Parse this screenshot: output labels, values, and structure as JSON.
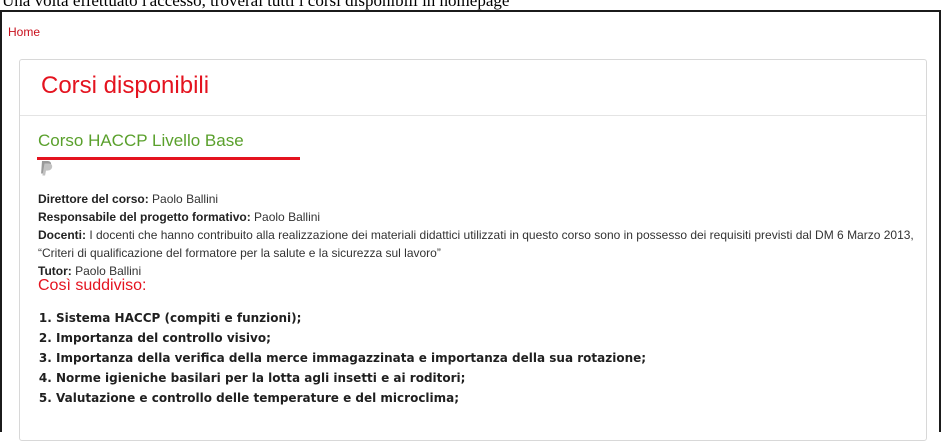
{
  "caption": "Una volta effettuato l'accesso, troverai tutti i corsi disponibili in homepage",
  "breadcrumb": {
    "home": "Home"
  },
  "panel": {
    "title": "Corsi disponibili",
    "course": {
      "title": "Corso HACCP Livello Base",
      "payment_icon": "paypal-icon",
      "director_label": "Direttore del corso:",
      "director_value": " Paolo Ballini",
      "manager_label": "Responsabile del progetto formativo:",
      "manager_value": " Paolo Ballini",
      "teachers_label": "Docenti:",
      "teachers_value": " I docenti che hanno contribuito alla realizzazione dei materiali didattici utilizzati in questo corso sono in possesso dei requisiti previsti dal DM 6 Marzo 2013, “Criteri di qualificazione del formatore per la salute e la sicurezza sul lavoro”",
      "tutor_label": "Tutor:",
      "tutor_value": " Paolo Ballini",
      "sections_heading": "Così suddiviso:",
      "topics": [
        "Sistema HACCP (compiti e funzioni);",
        "Importanza del controllo visivo;",
        "Importanza della verifica della merce immagazzinata e importanza della sua rotazione;",
        "Norme igieniche basilari per la lotta agli insetti e ai roditori;",
        "Valutazione e controllo delle temperature e del microclima;"
      ]
    }
  },
  "colors": {
    "accent_red": "#e4131f",
    "link_green": "#5aa02c",
    "border": "#d8d8d8"
  }
}
